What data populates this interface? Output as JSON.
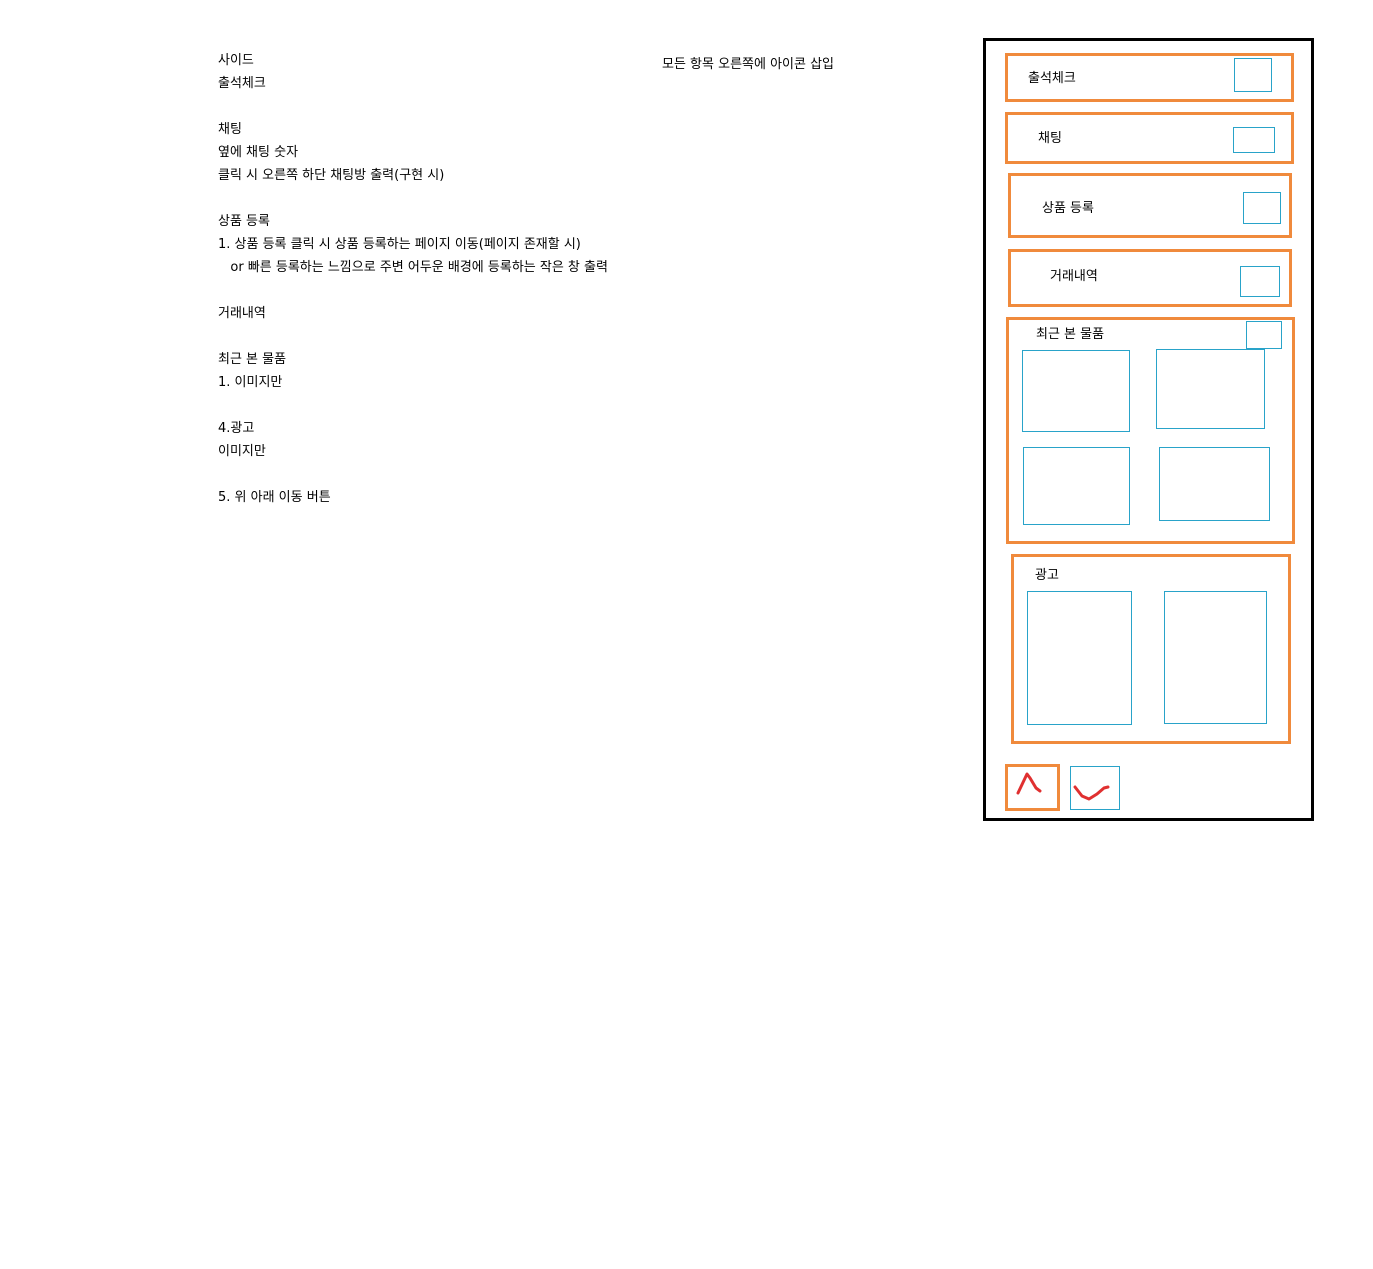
{
  "notes": {
    "lines": [
      "사이드",
      "출석체크",
      "",
      "채팅",
      "옆에 채팅 숫자",
      "클릭 시 오른쪽 하단 채팅방 출력(구현 시)",
      "",
      "상품 등록",
      "1. 상품 등록 클릭 시 상품 등록하는 페이지 이동(페이지 존재할 시)",
      "   or 빠른 등록하는 느낌으로 주변 어두운 배경에 등록하는 작은 창 출력",
      "",
      "거래내역",
      "",
      "최근 본 물품",
      "1. 이미지만",
      "",
      "4.광고",
      "이미지만",
      "",
      "5. 위 아래 이동 버튼"
    ],
    "top_note": "모든 항목 오른쪽에 아이콘 삽입"
  },
  "sidebar": {
    "attendance_label": "출석체크",
    "chat_label": "채팅",
    "product_register_label": "상품 등록",
    "transactions_label": "거래내역",
    "recent_items_label": "최근 본 물품",
    "ad_label": "광고",
    "up_icon": "chevron-up-icon",
    "down_icon": "chevron-down-icon"
  },
  "colors": {
    "orange": "#f08a3c",
    "blue": "#29a3c9",
    "red": "#e03030",
    "black": "#000000"
  }
}
